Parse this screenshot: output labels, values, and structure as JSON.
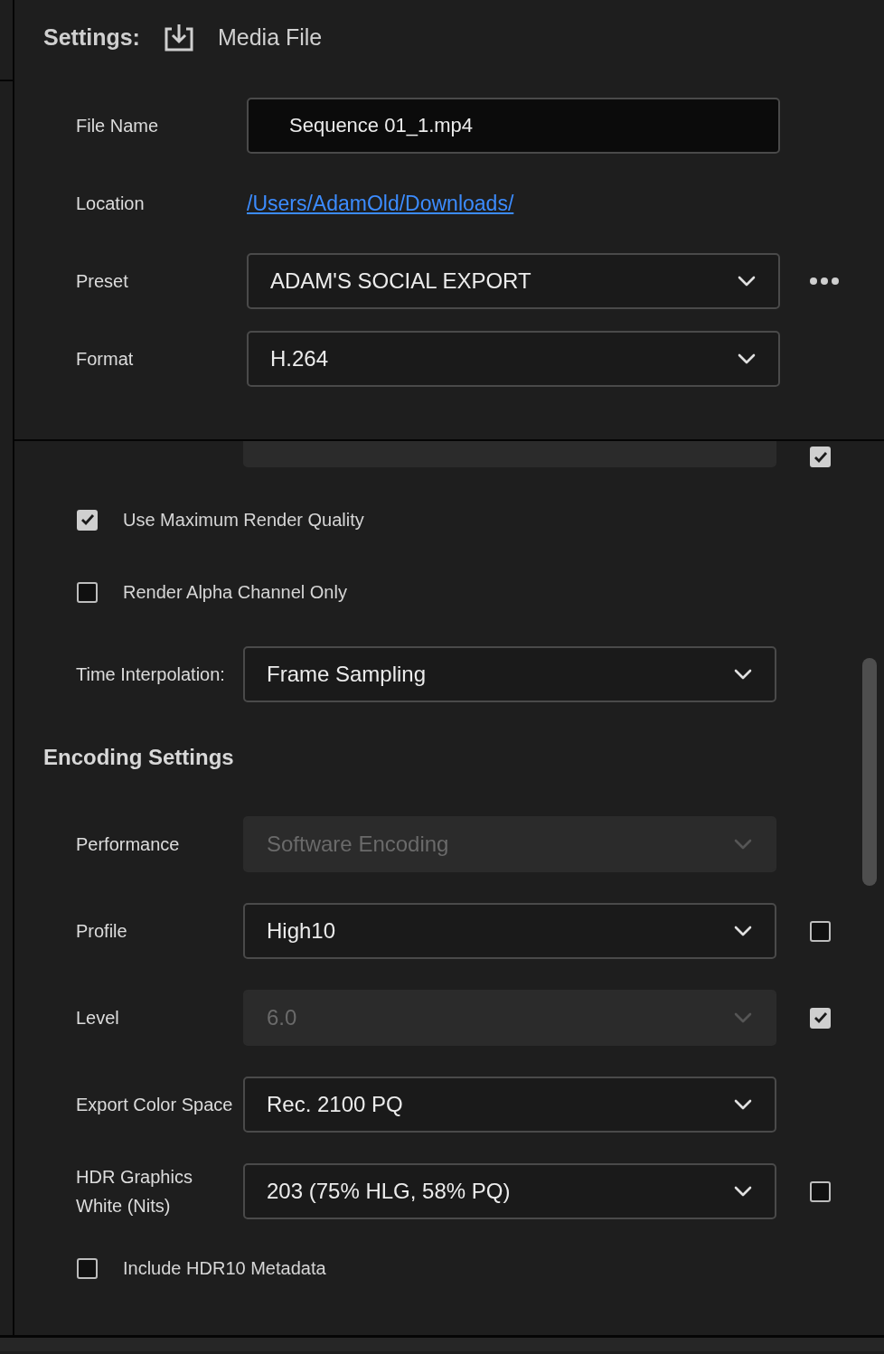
{
  "header": {
    "title": "Settings:",
    "destination": "Media File"
  },
  "fields": [
    {
      "kind": "input",
      "label": "File Name",
      "value": "Sequence 01_1.mp4"
    },
    {
      "kind": "link",
      "label": "Location",
      "value": "/Users/AdamOld/Downloads/"
    },
    {
      "kind": "select",
      "label": "Preset",
      "value": "ADAM'S SOCIAL EXPORT",
      "more": true
    },
    {
      "kind": "select",
      "label": "Format",
      "value": "H.264"
    }
  ],
  "rows": [
    {
      "kind": "clipped",
      "disabled": true,
      "checked": true
    },
    {
      "kind": "checkbox",
      "label": "Use Maximum Render Quality",
      "checked": true
    },
    {
      "kind": "checkbox",
      "label": "Render Alpha Channel Only",
      "checked": false
    },
    {
      "kind": "select",
      "label": "Time Interpolation:",
      "value": "Frame Sampling",
      "disabled": false
    },
    {
      "kind": "heading",
      "label": "Encoding Settings"
    },
    {
      "kind": "select",
      "label": "Performance",
      "value": "Software Encoding",
      "disabled": true
    },
    {
      "kind": "select",
      "label": "Profile",
      "value": "High10",
      "disabled": false,
      "checked": false
    },
    {
      "kind": "select",
      "label": "Level",
      "value": "6.0",
      "disabled": true,
      "checked": true
    },
    {
      "kind": "select",
      "label": "Export Color Space",
      "value": "Rec. 2100 PQ",
      "disabled": false
    },
    {
      "kind": "select",
      "label": "HDR Graphics White (Nits)",
      "value": "203 (75% HLG, 58% PQ)",
      "disabled": false,
      "checked": false
    },
    {
      "kind": "checkbox",
      "label": "Include HDR10 Metadata",
      "checked": false
    }
  ]
}
